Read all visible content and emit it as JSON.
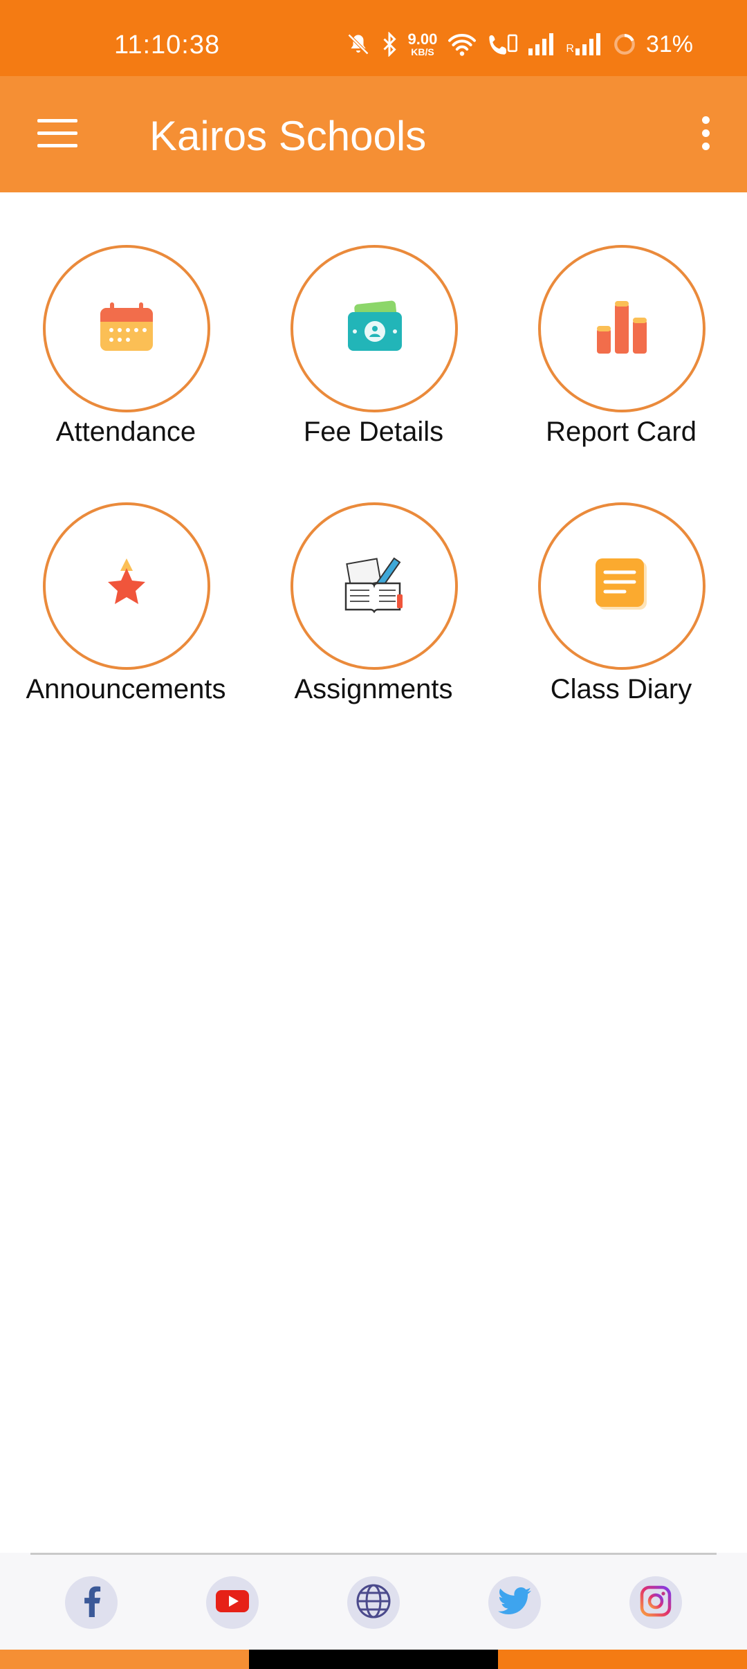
{
  "status_bar": {
    "time": "11:10:38",
    "speed_value": "9.00",
    "speed_unit": "KB/S",
    "roaming": "R",
    "battery": "31%",
    "icons": [
      "mute-icon",
      "bluetooth-icon",
      "wifi-icon",
      "volte-call-icon",
      "signal-icon",
      "signal-roaming-icon",
      "battery-ring-icon"
    ]
  },
  "app_bar": {
    "title": "Kairos Schools",
    "menu_icon": "hamburger-menu-icon",
    "overflow_icon": "more-vert-icon"
  },
  "tiles": [
    {
      "label": "Attendance",
      "icon": "calendar-icon"
    },
    {
      "label": "Fee Details",
      "icon": "money-icon"
    },
    {
      "label": "Report Card",
      "icon": "bar-chart-icon"
    },
    {
      "label": "Announcements",
      "icon": "star-icon"
    },
    {
      "label": "Assignments",
      "icon": "book-pencil-icon"
    },
    {
      "label": "Class Diary",
      "icon": "notes-icon"
    }
  ],
  "footer": {
    "links": [
      {
        "name": "facebook",
        "icon": "facebook-icon"
      },
      {
        "name": "youtube",
        "icon": "youtube-icon"
      },
      {
        "name": "website",
        "icon": "globe-icon"
      },
      {
        "name": "twitter",
        "icon": "twitter-icon"
      },
      {
        "name": "instagram",
        "icon": "instagram-icon"
      }
    ]
  },
  "colors": {
    "status_bar": "#f47b13",
    "app_bar": "#f58f34",
    "tile_ring": "#ea8a3b",
    "footer_bg": "#f7f7f9"
  }
}
